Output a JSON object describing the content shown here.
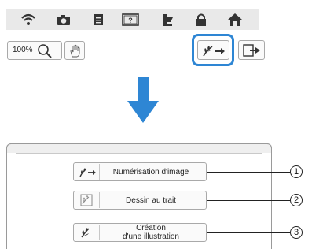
{
  "top_bar": {
    "icons": [
      "wifi-icon",
      "camera-icon",
      "document-icon",
      "help-icon",
      "embroidery-foot-icon",
      "lock-icon",
      "home-icon"
    ]
  },
  "toolbar": {
    "zoom_label": "100%",
    "zoom_icon": "magnifier-icon",
    "hand_icon": "hand-pan-icon",
    "scan_icon": "image-scan-arrow-icon",
    "next_icon": "next-page-icon"
  },
  "annotation": {
    "highlight_color": "#2e86d4",
    "arrow_color": "#2e86d4"
  },
  "menu": {
    "items": [
      {
        "label": "Numérisation d'image",
        "number": "1",
        "icon": "image-scan-icon"
      },
      {
        "label": "Dessin au trait",
        "number": "2",
        "icon": "line-drawing-icon"
      },
      {
        "label": "Création\nd'une illustration",
        "number": "3",
        "icon": "illustration-icon"
      }
    ]
  }
}
